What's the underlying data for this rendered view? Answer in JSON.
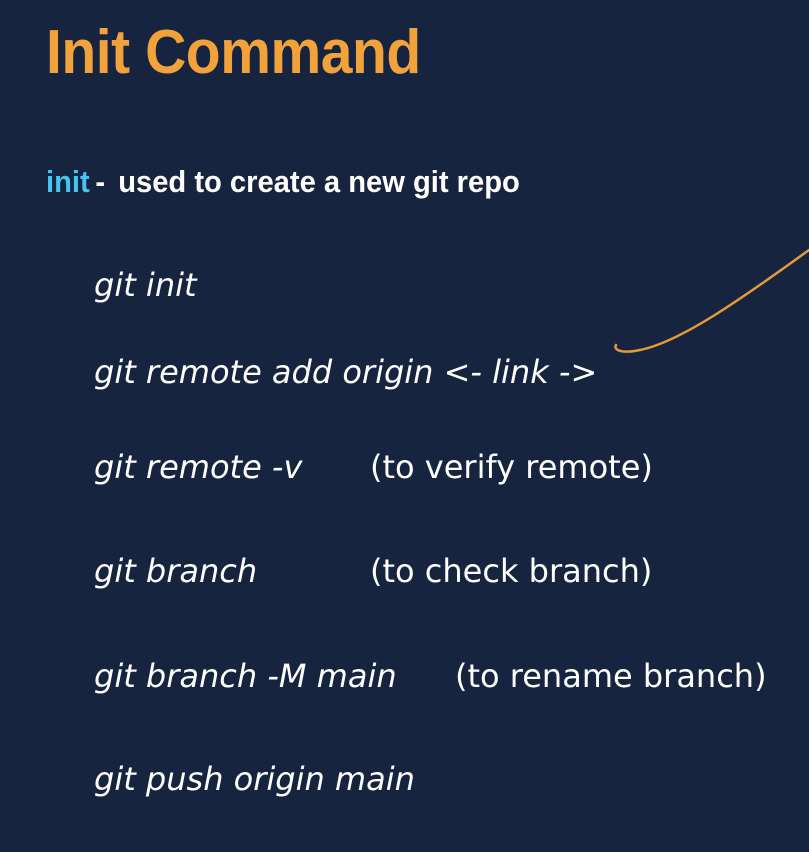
{
  "slide": {
    "title": "Init Command",
    "subtitle": {
      "keyword": "init",
      "dash": "-",
      "description": "used to create a new git repo"
    },
    "commands": [
      {
        "command": "git init",
        "note": ""
      },
      {
        "command": "git remote add origin <- link ->",
        "note": ""
      },
      {
        "command": "git remote -v",
        "note": "(to verify remote)"
      },
      {
        "command": "git branch",
        "note": "(to check branch)"
      },
      {
        "command": "git branch -M main",
        "note": "(to rename branch)"
      },
      {
        "command": "git push origin main",
        "note": ""
      }
    ]
  },
  "colors": {
    "background": "#16243f",
    "title": "#f2a23a",
    "keyword": "#45c6ee",
    "text": "#ffffff",
    "annotation_stroke": "#e59a3a"
  }
}
